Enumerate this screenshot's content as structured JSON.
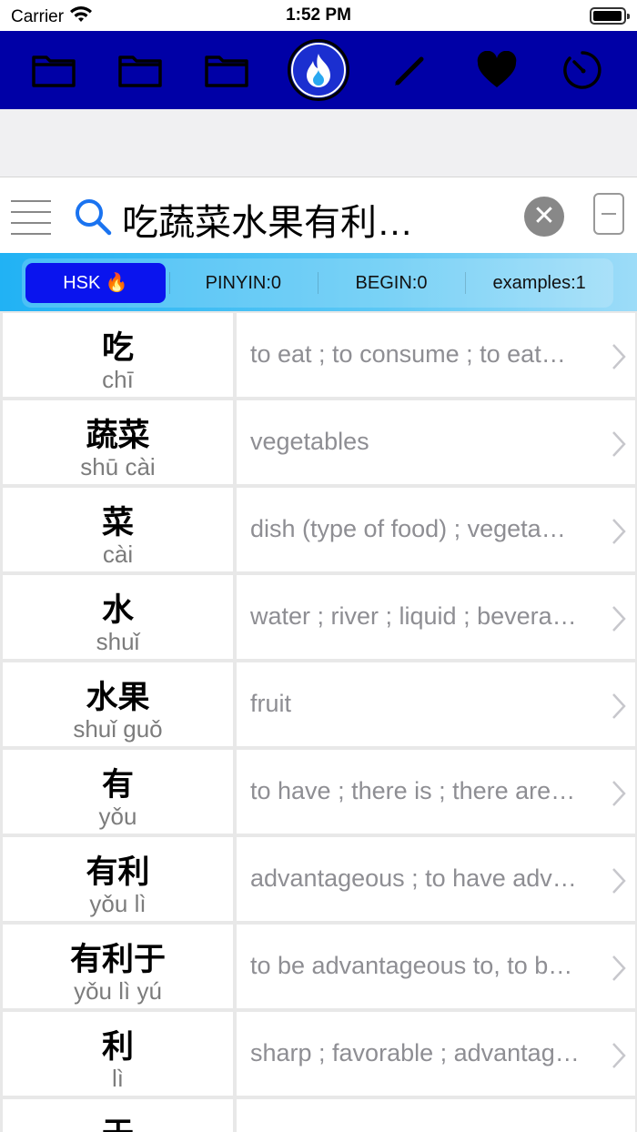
{
  "status_bar": {
    "carrier": "Carrier",
    "time": "1:52 PM"
  },
  "toolbar": {
    "items": [
      {
        "icon": "folder-icon"
      },
      {
        "icon": "folder-icon"
      },
      {
        "icon": "folder-icon"
      },
      {
        "icon": "fire-icon"
      },
      {
        "icon": "pencil-icon"
      },
      {
        "icon": "heart-icon"
      },
      {
        "icon": "timer-icon"
      }
    ],
    "colors": {
      "background": "#0000a6"
    }
  },
  "search": {
    "query": "吃蔬菜水果有利…"
  },
  "filters": {
    "hsk_label": "HSK 🔥",
    "pinyin_label": "PINYIN:0",
    "begin_label": "BEGIN:0",
    "examples_label": "examples:1",
    "active_color": "#0a14ee"
  },
  "entries": [
    {
      "hanzi": "吃",
      "pinyin": "chī",
      "meaning": "to eat ; to consume ; to eat…"
    },
    {
      "hanzi": "蔬菜",
      "pinyin": "shū cài",
      "meaning": "vegetables"
    },
    {
      "hanzi": "菜",
      "pinyin": "cài",
      "meaning": "dish (type of food) ; vegeta…"
    },
    {
      "hanzi": "水",
      "pinyin": "shuǐ",
      "meaning": "water ; river ; liquid ; bevera…"
    },
    {
      "hanzi": "水果",
      "pinyin": "shuǐ guǒ",
      "meaning": "fruit"
    },
    {
      "hanzi": "有",
      "pinyin": "yǒu",
      "meaning": "to have ; there is ; there are…"
    },
    {
      "hanzi": "有利",
      "pinyin": "yǒu lì",
      "meaning": "advantageous ; to have adv…"
    },
    {
      "hanzi": "有利于",
      "pinyin": "yǒu lì yú",
      "meaning": "to be advantageous to, to b…"
    },
    {
      "hanzi": "利",
      "pinyin": "lì",
      "meaning": "sharp ; favorable ; advantag…"
    },
    {
      "hanzi": "于",
      "pinyin": "",
      "meaning": ""
    }
  ]
}
